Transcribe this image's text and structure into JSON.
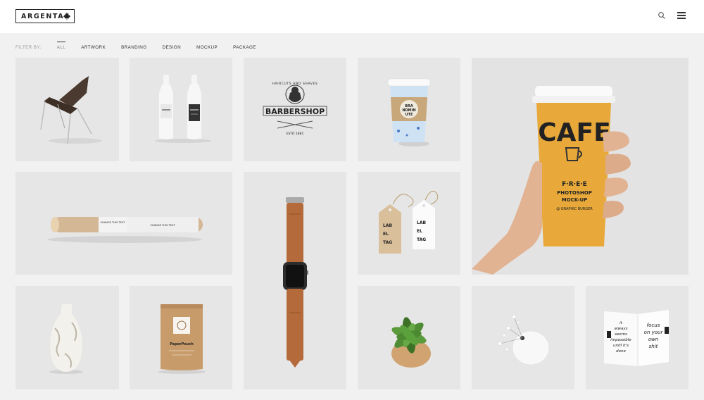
{
  "header": {
    "logo_text": "ARGENTA",
    "logo_icon": "maple-leaf-icon",
    "search_icon": "search-icon",
    "menu_icon": "hamburger-menu-icon"
  },
  "filter": {
    "label": "FILTER BY:",
    "items": [
      "ALL",
      "ARTWORK",
      "BRANDING",
      "DESIGN",
      "MOCKUP",
      "PACKAGE"
    ],
    "active": "ALL"
  },
  "tiles": {
    "barber": {
      "top_text": "HAIRCUTS AND SHAVES",
      "title": "BARBERSHOP",
      "est": "ESTD 1881"
    },
    "cup": {
      "sleeve": [
        "BRA",
        "NDMIN",
        "UTE"
      ]
    },
    "tube": {
      "label_left": "CHANGE THIS TEXT",
      "label_right": "CHANGE THIS TEXT"
    },
    "tags": {
      "tag1": [
        "LAB",
        "EL",
        "TAG"
      ],
      "tag2": [
        "LAB",
        "EL",
        "TAG"
      ]
    },
    "pouch": {
      "brand": "PaperPouch"
    },
    "hand_cup": {
      "big_letters": "CAFE",
      "line1": "F·R·E·E",
      "line2": "PHOTOSHOP",
      "line3": "MOCK-UP",
      "line4": "@ GRAPHIC BURGER"
    },
    "book": {
      "left_page": [
        "it",
        "always",
        "seems",
        "impossible",
        "until it's",
        "done"
      ],
      "right_page": [
        "focus",
        "on your",
        "own",
        "shit"
      ]
    }
  },
  "colors": {
    "tile_bg": "#e6e6e6",
    "page_bg": "#f1f1f1",
    "cup_yellow": "#e8a93a",
    "kraft": "#c89b6b"
  }
}
